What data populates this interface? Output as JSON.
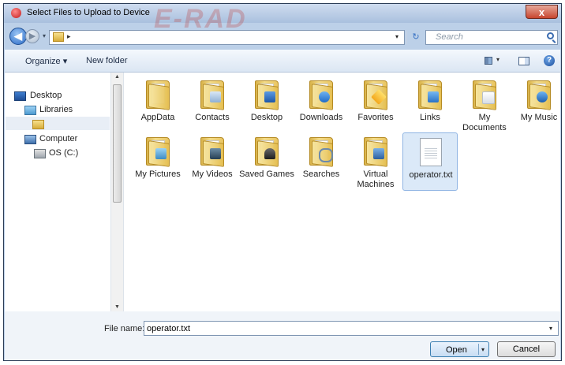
{
  "window": {
    "title": "Select Files to Upload to Device",
    "watermark": "E-RAD",
    "close_label": "x"
  },
  "navbar": {
    "back_glyph": "◀",
    "forward_glyph": "▶",
    "address_arrow": "▸",
    "search_placeholder": "Search"
  },
  "toolbar": {
    "organize_label": "Organize ▾",
    "new_folder_label": "New folder",
    "help_glyph": "?"
  },
  "nav_tree": [
    {
      "label": "Desktop",
      "icon": "desktop-icon"
    },
    {
      "label": "Libraries",
      "icon": "libraries-icon"
    },
    {
      "label": "",
      "icon": "user-folder-icon",
      "selected": true
    },
    {
      "label": "Computer",
      "icon": "computer-icon"
    },
    {
      "label": "OS (C:)",
      "icon": "drive-icon"
    }
  ],
  "files": [
    {
      "label": "AppData",
      "icon": "folder-icon"
    },
    {
      "label": "Contacts",
      "icon": "contacts-folder-icon"
    },
    {
      "label": "Desktop",
      "icon": "desktop-folder-icon"
    },
    {
      "label": "Downloads",
      "icon": "downloads-folder-icon"
    },
    {
      "label": "Favorites",
      "icon": "favorites-folder-icon"
    },
    {
      "label": "Links",
      "icon": "links-folder-icon"
    },
    {
      "label": "My Documents",
      "icon": "documents-folder-icon"
    },
    {
      "label": "My Music",
      "icon": "music-folder-icon"
    },
    {
      "label": "My Pictures",
      "icon": "pictures-folder-icon"
    },
    {
      "label": "My Videos",
      "icon": "videos-folder-icon"
    },
    {
      "label": "Saved Games",
      "icon": "games-folder-icon"
    },
    {
      "label": "Searches",
      "icon": "searches-folder-icon"
    },
    {
      "label": "Virtual Machines",
      "icon": "vm-folder-icon"
    },
    {
      "label": "operator.txt",
      "icon": "text-file-icon",
      "selected": true
    }
  ],
  "footer": {
    "filename_label": "File name:",
    "filename_value": "operator.txt",
    "open_label": "Open",
    "cancel_label": "Cancel"
  },
  "colors": {
    "accent": "#3c7fb1",
    "selection": "#dbe9f8",
    "folder": "#e9c562"
  }
}
